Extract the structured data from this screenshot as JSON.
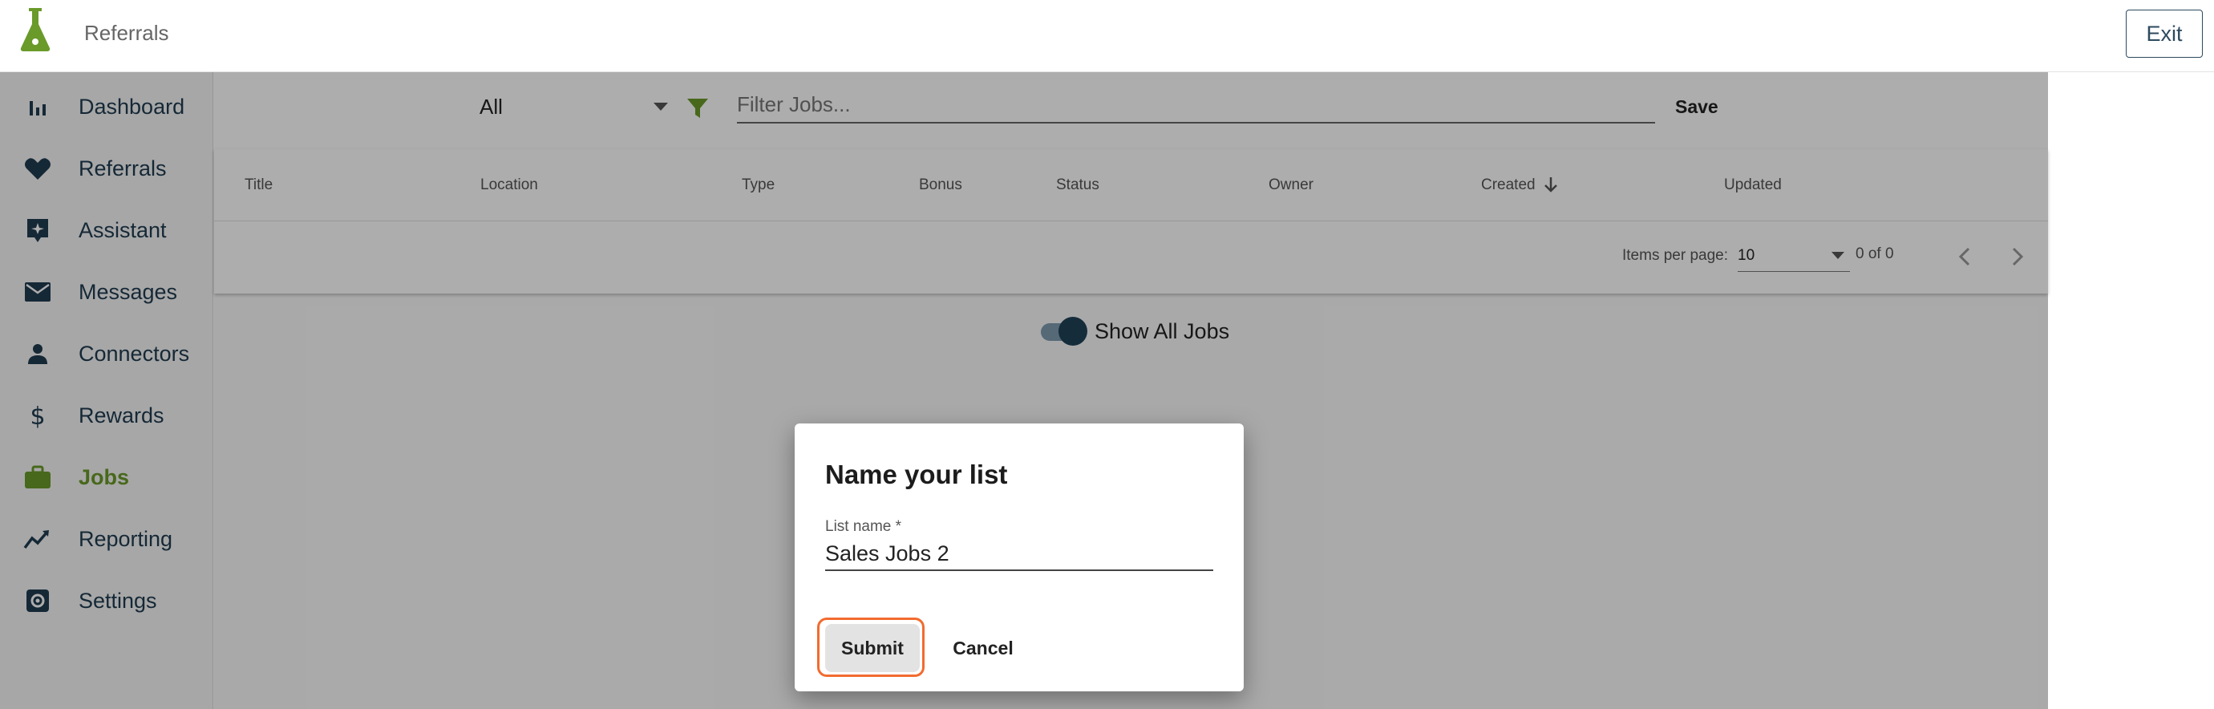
{
  "header": {
    "title": "Referrals",
    "exit_label": "Exit",
    "logo_icon": "flask-logo-icon"
  },
  "colors": {
    "accent": "#6a9a2a",
    "nav_text": "#1f3c50",
    "highlight": "#f26b2f"
  },
  "sidebar": {
    "items": [
      {
        "label": "Dashboard",
        "icon": "bar-chart-icon",
        "active": false
      },
      {
        "label": "Referrals",
        "icon": "heart-icon",
        "active": false
      },
      {
        "label": "Assistant",
        "icon": "assistant-sparkle-icon",
        "active": false
      },
      {
        "label": "Messages",
        "icon": "envelope-icon",
        "active": false
      },
      {
        "label": "Connectors",
        "icon": "person-icon",
        "active": false
      },
      {
        "label": "Rewards",
        "icon": "dollar-icon",
        "active": false
      },
      {
        "label": "Jobs",
        "icon": "briefcase-icon",
        "active": true
      },
      {
        "label": "Reporting",
        "icon": "trend-icon",
        "active": false
      },
      {
        "label": "Settings",
        "icon": "settings-icon",
        "active": false
      }
    ]
  },
  "filters": {
    "selected": "All",
    "placeholder": "Filter Jobs...",
    "save_label": "Save",
    "filter_icon": "funnel-icon"
  },
  "table": {
    "columns": [
      "Title",
      "Location",
      "Type",
      "Bonus",
      "Status",
      "Owner",
      "Created",
      "Updated"
    ],
    "sorted_column": "Created",
    "sort_direction": "descending"
  },
  "paginator": {
    "items_per_page_label": "Items per page:",
    "items_per_page_value": "10",
    "range_label": "0 of 0"
  },
  "toggle": {
    "label": "Show All Jobs",
    "checked": true
  },
  "dialog": {
    "title": "Name your list",
    "field_label": "List name *",
    "field_value": "Sales Jobs 2",
    "submit_label": "Submit",
    "cancel_label": "Cancel"
  }
}
